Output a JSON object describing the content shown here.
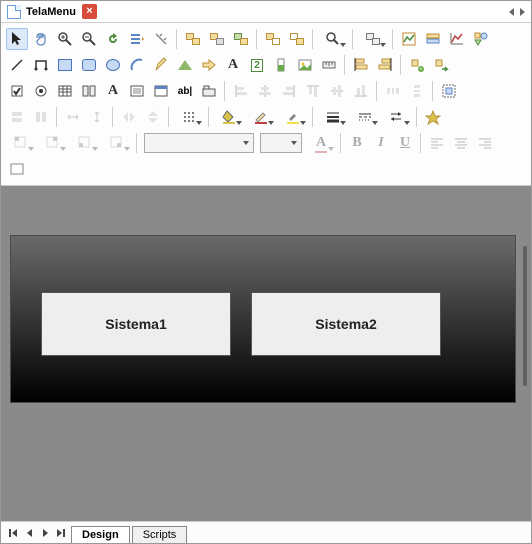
{
  "title": "TelaMenu",
  "canvas": {
    "button1": "Sistema1",
    "button2": "Sistema2"
  },
  "tabs": {
    "design": "Design",
    "scripts": "Scripts"
  },
  "format": {
    "font_family": "",
    "font_size": "",
    "bold": "B",
    "italic": "I",
    "underline": "U"
  },
  "text": {
    "A": "A",
    "two": "2",
    "abl": "ab|"
  }
}
